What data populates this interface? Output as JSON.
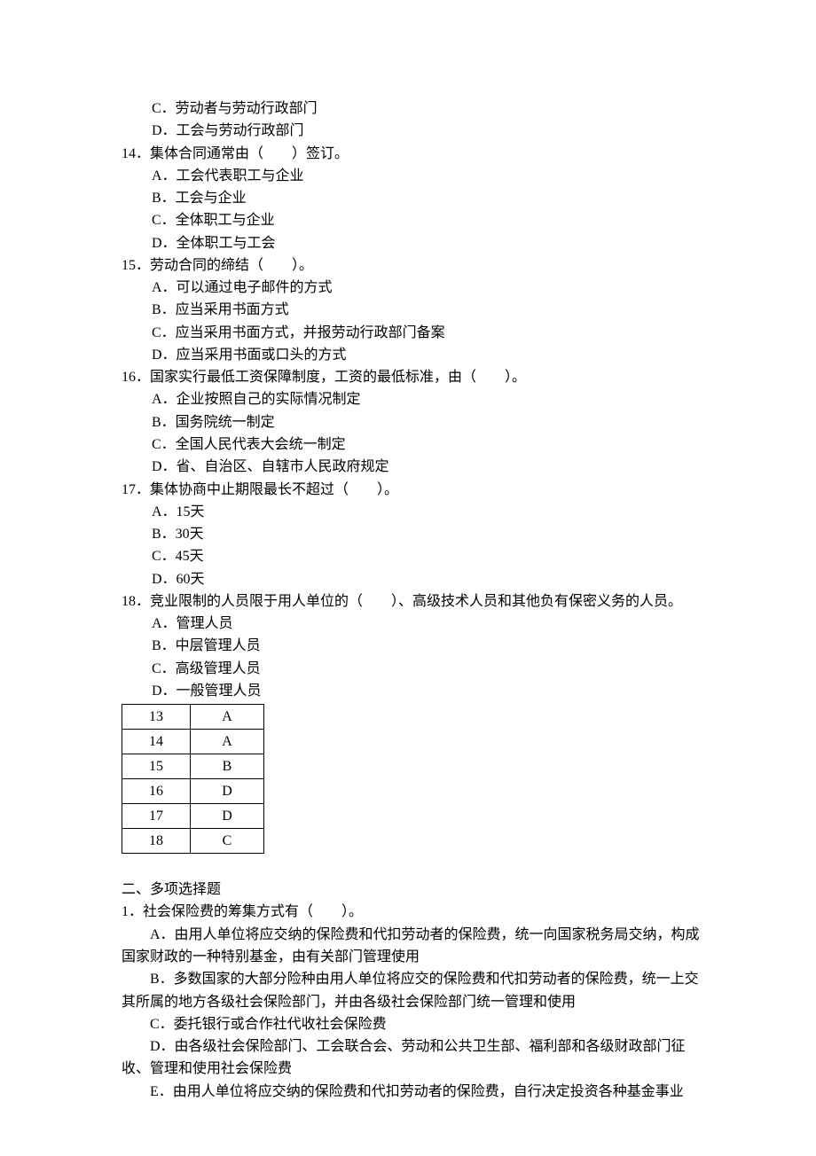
{
  "prev_options": {
    "c": "C．劳动者与劳动行政部门",
    "d": "D．工会与劳动行政部门"
  },
  "q14": {
    "stem": "14．集体合同通常由（　　）签订。",
    "a": "A．工会代表职工与企业",
    "b": "B．工会与企业",
    "c": "C．全体职工与企业",
    "d": "D．全体职工与工会"
  },
  "q15": {
    "stem": "15．劳动合同的缔结（　　）。",
    "a": "A．可以通过电子邮件的方式",
    "b": "B．应当采用书面方式",
    "c": "C．应当采用书面方式，并报劳动行政部门备案",
    "d": "D．应当采用书面或口头的方式"
  },
  "q16": {
    "stem": "16．国家实行最低工资保障制度，工资的最低标准，由（　　）。",
    "a": "A．企业按照自己的实际情况制定",
    "b": "B．国务院统一制定",
    "c": "C．全国人民代表大会统一制定",
    "d": "D．省、自治区、自辖市人民政府规定"
  },
  "q17": {
    "stem": "17．集体协商中止期限最长不超过（　　）。",
    "a": "A．15天",
    "b": "B．30天",
    "c": "C．45天",
    "d": "D．60天"
  },
  "q18": {
    "stem": "18．竞业限制的人员限于用人单位的（　　）、高级技术人员和其他负有保密义务的人员。",
    "a": "A．管理人员",
    "b": "B．中层管理人员",
    "c": "C．高级管理人员",
    "d": "D．一般管理人员"
  },
  "answers": [
    {
      "num": "13",
      "ans": "A"
    },
    {
      "num": "14",
      "ans": "A"
    },
    {
      "num": "15",
      "ans": "B"
    },
    {
      "num": "16",
      "ans": "D"
    },
    {
      "num": "17",
      "ans": "D"
    },
    {
      "num": "18",
      "ans": "C"
    }
  ],
  "section2": {
    "heading": "二、多项选择题",
    "q1": {
      "stem": "1．社会保险费的筹集方式有（　　）。",
      "a": "A．由用人单位将应交纳的保险费和代扣劳动者的保险费，统一向国家税务局交纳，构成国家财政的一种特别基金，由有关部门管理使用",
      "b": "B．多数国家的大部分险种由用人单位将应交的保险费和代扣劳动者的保险费，统一上交其所属的地方各级社会保险部门，并由各级社会保险部门统一管理和使用",
      "c": "C．委托银行或合作社代收社会保险费",
      "d": "D．由各级社会保险部门、工会联合会、劳动和公共卫生部、福利部和各级财政部门征收、管理和使用社会保险费",
      "e": "E．由用人单位将应交纳的保险费和代扣劳动者的保险费，自行决定投资各种基金事业"
    }
  }
}
